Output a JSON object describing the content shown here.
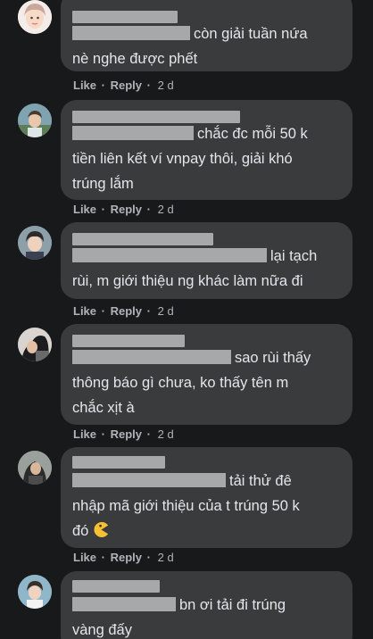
{
  "comments": [
    {
      "text_lines": [
        "còn giải tuần nứa",
        "nè nghe được phết"
      ],
      "like": "Like",
      "reply": "Reply",
      "time": "2 d"
    },
    {
      "text_lines": [
        "chắc đc mỗi 50 k",
        "tiền liên kết ví vnpay thôi, giải khó",
        "trúng lắm"
      ],
      "like": "Like",
      "reply": "Reply",
      "time": "2 d"
    },
    {
      "text_lines": [
        "lại tạch",
        "rùi, m giới thiệu ng khác làm nữa đi"
      ],
      "like": "Like",
      "reply": "Reply",
      "time": "2 d"
    },
    {
      "text_lines": [
        "sao rùi thấy",
        "thông báo gì chưa, ko thấy tên m",
        "chắc xịt à"
      ],
      "like": "Like",
      "reply": "Reply",
      "time": "2 d"
    },
    {
      "text_lines": [
        "tải thử đê",
        "nhập mã giới thiệu của t trúng 50 k",
        "đó"
      ],
      "like": "Like",
      "reply": "Reply",
      "time": "2 d",
      "emoji": "pacman-emoji-icon"
    },
    {
      "text_lines": [
        "bn ơi tải đi trúng",
        "vàng đấy"
      ],
      "like": "",
      "reply": "",
      "time": ""
    }
  ],
  "colors": {
    "background": "#18191a",
    "bubble": "#3a3b3c",
    "text": "#e4e6eb",
    "secondary_text": "#b0b3b8",
    "redaction": "#a7a8aa"
  },
  "separator": "·"
}
